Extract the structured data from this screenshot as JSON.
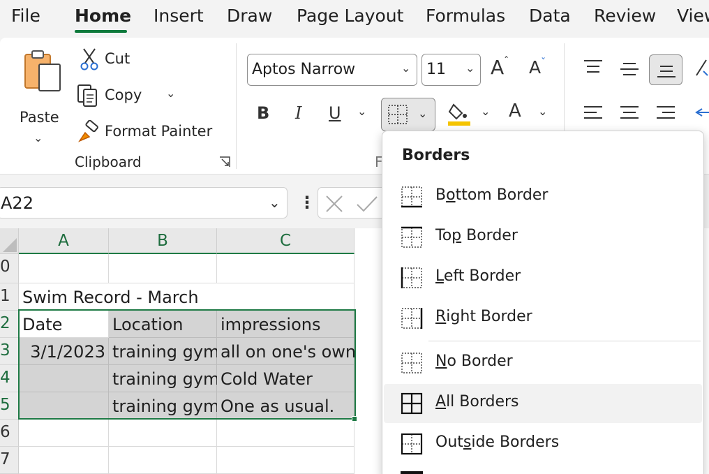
{
  "menubar": {
    "tabs": [
      {
        "label": "File"
      },
      {
        "label": "Home"
      },
      {
        "label": "Insert"
      },
      {
        "label": "Draw"
      },
      {
        "label": "Page Layout"
      },
      {
        "label": "Formulas"
      },
      {
        "label": "Data"
      },
      {
        "label": "Review"
      },
      {
        "label": "View"
      }
    ],
    "active_tab": "Home",
    "accent_color": "#0f7a3c"
  },
  "clipboard": {
    "paste_label": "Paste",
    "cut_label": "Cut",
    "copy_label": "Copy",
    "format_painter_label": "Format Painter",
    "group_label": "Clipboard"
  },
  "font": {
    "family": "Aptos Narrow",
    "size": "11",
    "grow_glyph": "A",
    "shrink_glyph": "A",
    "bold_glyph": "B",
    "italic_glyph": "I",
    "underline_glyph": "U",
    "font_color_glyph": "A",
    "group_label_partial": "F",
    "fill_color": "#f5c400"
  },
  "namebox": {
    "value": "A22"
  },
  "sheet": {
    "columns": [
      "A",
      "B",
      "C"
    ],
    "rows": [
      {
        "num": "0",
        "cells": [
          "",
          "",
          ""
        ]
      },
      {
        "num": "1",
        "cells": [
          "Swim Record - March",
          "",
          ""
        ]
      },
      {
        "num": "2",
        "cells": [
          "Date",
          "Location",
          "impressions"
        ]
      },
      {
        "num": "3",
        "cells": [
          "3/1/2023",
          "training gym",
          "all on one's own"
        ]
      },
      {
        "num": "4",
        "cells": [
          "",
          "training gym",
          "Cold Water"
        ]
      },
      {
        "num": "5",
        "cells": [
          "",
          "training gym",
          "One as usual."
        ]
      },
      {
        "num": "6",
        "cells": [
          "",
          "",
          ""
        ]
      },
      {
        "num": "7",
        "cells": [
          "",
          "",
          ""
        ]
      }
    ],
    "selection_color": "#1e7a45",
    "shade_color": "#d4d4d4"
  },
  "borders_menu": {
    "title": "Borders",
    "items": [
      {
        "pre": "B",
        "key": "o",
        "post": "ttom Border",
        "icon": "bottom-border-icon"
      },
      {
        "pre": "To",
        "key": "p",
        "post": " Border",
        "icon": "top-border-icon"
      },
      {
        "pre": "",
        "key": "L",
        "post": "eft Border",
        "icon": "left-border-icon"
      },
      {
        "pre": "",
        "key": "R",
        "post": "ight Border",
        "icon": "right-border-icon"
      },
      {
        "pre": "",
        "key": "N",
        "post": "o Border",
        "icon": "no-border-icon"
      },
      {
        "pre": "",
        "key": "A",
        "post": "ll Borders",
        "icon": "all-borders-icon"
      },
      {
        "pre": "Out",
        "key": "s",
        "post": "ide Borders",
        "icon": "outside-borders-icon"
      }
    ],
    "highlighted_item": "All Borders"
  }
}
